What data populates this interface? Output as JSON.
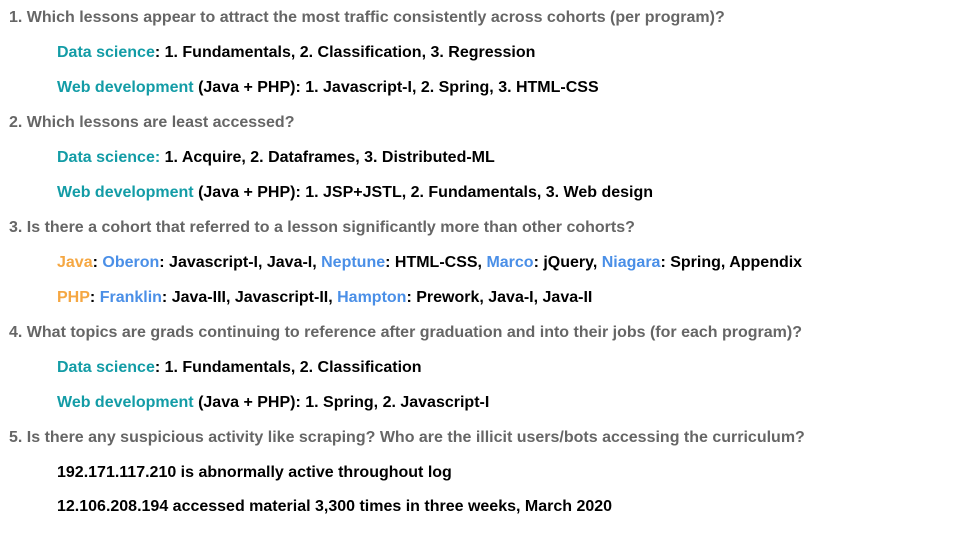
{
  "q1": {
    "question": "1. Which lessons appear to attract the most traffic consistently across cohorts (per program)?",
    "ds": {
      "program": "Data science",
      "sep": ":",
      "text": " 1. Fundamentals, 2. Classification, 3. Regression"
    },
    "web": {
      "program": "Web development",
      "text": " (Java + PHP): 1. Javascript-I, 2. Spring, 3. HTML-CSS"
    }
  },
  "q2": {
    "question": "2. Which lessons are least accessed?",
    "ds": {
      "program": "Data science:",
      "text": " 1. Acquire, 2. Dataframes, 3. Distributed-ML"
    },
    "web": {
      "program": "Web development",
      "text": " (Java + PHP): 1. JSP+JSTL, 2. Fundamentals, 3. Web design"
    }
  },
  "q3": {
    "question": "3. Is there a cohort that referred to a lesson significantly more than other cohorts?",
    "java": {
      "program": "Java",
      "oberon": {
        "name": "Oberon",
        "text": ": Javascript-I, Java-I, "
      },
      "neptune": {
        "name": "Neptune",
        "text": ": HTML-CSS, "
      },
      "marco": {
        "name": "Marco",
        "text": ": jQuery, "
      },
      "niagara": {
        "name": "Niagara",
        "text": ": Spring, Appendix"
      }
    },
    "php": {
      "program": "PHP",
      "franklin": {
        "name": "Franklin",
        "text": ": Java-III, Javascript-II, "
      },
      "hampton": {
        "name": "Hampton",
        "text": ": Prework, Java-I, Java-II"
      }
    }
  },
  "q4": {
    "question": "4. What topics are grads continuing to reference after graduation and into their jobs (for each program)?",
    "ds": {
      "program": "Data science",
      "sep": ":",
      "text": " 1. Fundamentals, 2. Classification"
    },
    "web": {
      "program": "Web development",
      "text": " (Java + PHP): 1. Spring, 2. Javascript-I"
    }
  },
  "q5": {
    "question": "5. Is there any suspicious activity like scraping? Who are the illicit users/bots accessing the curriculum?",
    "a1": "192.171.117.210 is abnormally active throughout log",
    "a2": "12.106.208.194 accessed material 3,300 times in three weeks, March 2020"
  },
  "colors": {
    "question": "#666666",
    "answer": "#000000",
    "program": "#139ca6",
    "cohort": "#4a8fe7",
    "java_php": "#f5a742"
  }
}
